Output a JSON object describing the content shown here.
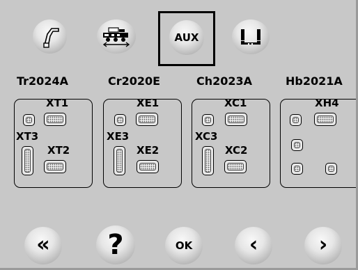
{
  "top_buttons": [
    {
      "name": "crane-arm-button",
      "icon": "crane-arm-icon"
    },
    {
      "name": "truck-mixer-button",
      "icon": "truck-mixer-icon"
    },
    {
      "name": "aux-button",
      "label": "AUX",
      "selected": true
    },
    {
      "name": "warning-alert-button",
      "icon": "warning-bracket-icon"
    }
  ],
  "groups": [
    {
      "title": "Tr2024A",
      "connectors": {
        "top": "XT1",
        "left": "XT3",
        "right": "XT2"
      }
    },
    {
      "title": "Cr2020E",
      "connectors": {
        "top": "XE1",
        "left": "XE3",
        "right": "XE2"
      }
    },
    {
      "title": "Ch2023A",
      "connectors": {
        "top": "XC1",
        "left": "XC3",
        "right": "XC2"
      }
    },
    {
      "title": "Hb2021A",
      "connectors": {
        "top": "XH4"
      }
    }
  ],
  "bottom_buttons": [
    {
      "name": "back-double-button",
      "label": "«"
    },
    {
      "name": "help-button",
      "label": "?"
    },
    {
      "name": "ok-button",
      "label": "OK"
    },
    {
      "name": "prev-button",
      "label": "‹"
    },
    {
      "name": "next-button",
      "label": "›"
    }
  ],
  "colors": {
    "background": "#c8c8c8",
    "outline": "#000000",
    "button_face": "#e6e6e6"
  }
}
